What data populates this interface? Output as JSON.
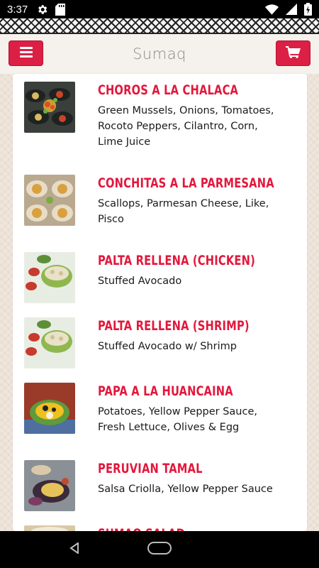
{
  "status_bar": {
    "time": "3:37",
    "icons": [
      "gear-icon",
      "sd-card-icon",
      "wifi-icon",
      "signal-icon",
      "battery-charging-icon"
    ]
  },
  "header": {
    "title": "Sumaq",
    "menu_icon": "hamburger-menu-icon",
    "cart_icon": "shopping-cart-icon",
    "accent_color": "#dc1f45"
  },
  "menu": {
    "name_color": "#e3173c",
    "items": [
      {
        "name": "CHOROS A LA CHALACA",
        "desc_lines": [
          "Green Mussels, Onions, Tomatoes,",
          "Rocoto Peppers, Cilantro, Corn,",
          "Lime Juice"
        ]
      },
      {
        "name": "CONCHITAS A LA PARMESANA",
        "desc_lines": [
          "Scallops, Parmesan Cheese, Like,",
          "Pisco"
        ]
      },
      {
        "name": "PALTA RELLENA (CHICKEN)",
        "desc_lines": [
          "Stuffed Avocado"
        ]
      },
      {
        "name": "PALTA RELLENA (SHRIMP)",
        "desc_lines": [
          "Stuffed Avocado w/ Shrimp"
        ]
      },
      {
        "name": "PAPA A LA HUANCAINA",
        "desc_lines": [
          "Potatoes, Yellow Pepper Sauce,",
          "Fresh Lettuce, Olives & Egg"
        ]
      },
      {
        "name": "PERUVIAN TAMAL",
        "desc_lines": [
          "Salsa Criolla, Yellow Pepper Sauce"
        ]
      },
      {
        "name": "SUMAQ SALAD",
        "desc_lines": []
      }
    ]
  },
  "nav_bar": {
    "icons": [
      "back-icon",
      "home-icon",
      "recents-icon"
    ]
  }
}
